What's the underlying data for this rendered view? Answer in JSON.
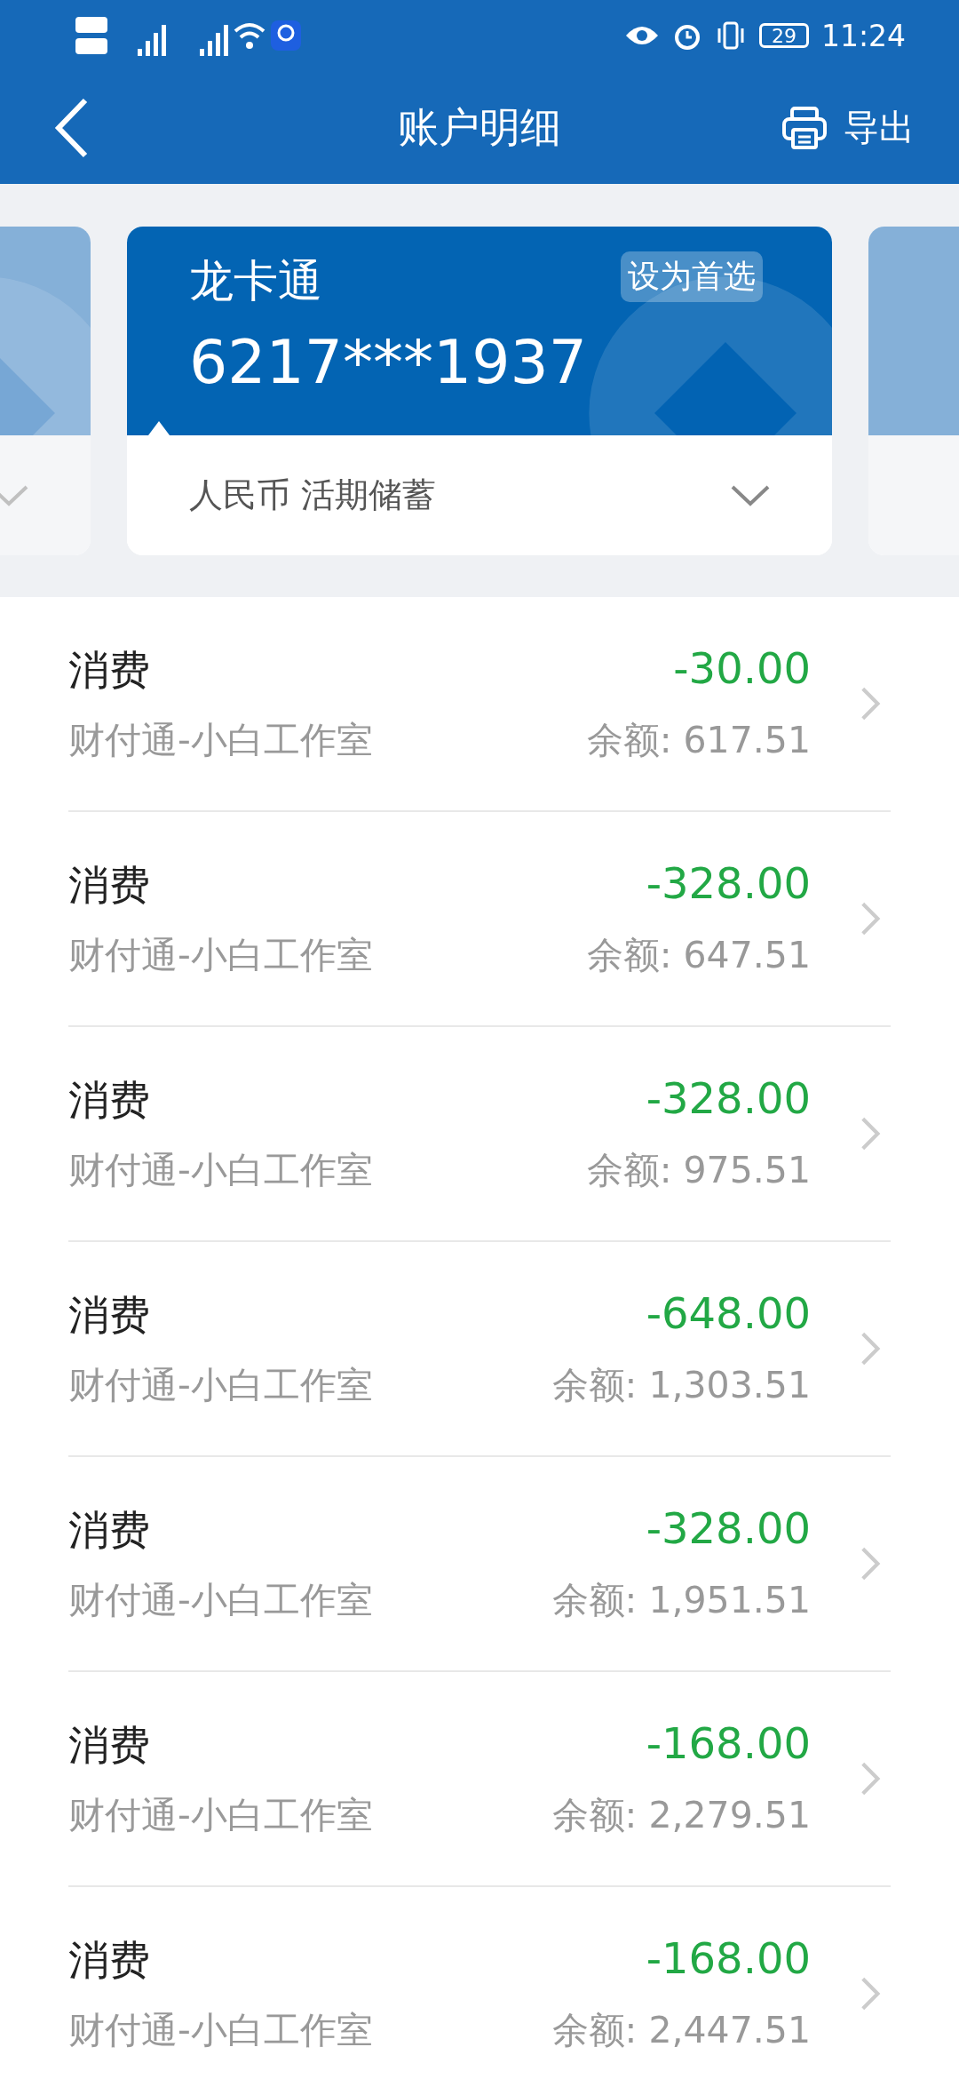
{
  "status_bar": {
    "time": "11:24",
    "battery": "29"
  },
  "header": {
    "title": "账户明细",
    "export": "导出"
  },
  "card": {
    "name": "龙卡通",
    "number": "6217***1937",
    "preferred_button": "设为首选",
    "account_type": "人民币 活期储蓄"
  },
  "transactions": [
    {
      "title": "消费",
      "merchant": "财付通-小白工作室",
      "amount": "-30.00",
      "balance": "余额: 617.51"
    },
    {
      "title": "消费",
      "merchant": "财付通-小白工作室",
      "amount": "-328.00",
      "balance": "余额: 647.51"
    },
    {
      "title": "消费",
      "merchant": "财付通-小白工作室",
      "amount": "-328.00",
      "balance": "余额: 975.51"
    },
    {
      "title": "消费",
      "merchant": "财付通-小白工作室",
      "amount": "-648.00",
      "balance": "余额: 1,303.51"
    },
    {
      "title": "消费",
      "merchant": "财付通-小白工作室",
      "amount": "-328.00",
      "balance": "余额: 1,951.51"
    },
    {
      "title": "消费",
      "merchant": "财付通-小白工作室",
      "amount": "-168.00",
      "balance": "余额: 2,279.51"
    },
    {
      "title": "消费",
      "merchant": "财付通-小白工作室",
      "amount": "-168.00",
      "balance": "余额: 2,447.51"
    }
  ]
}
